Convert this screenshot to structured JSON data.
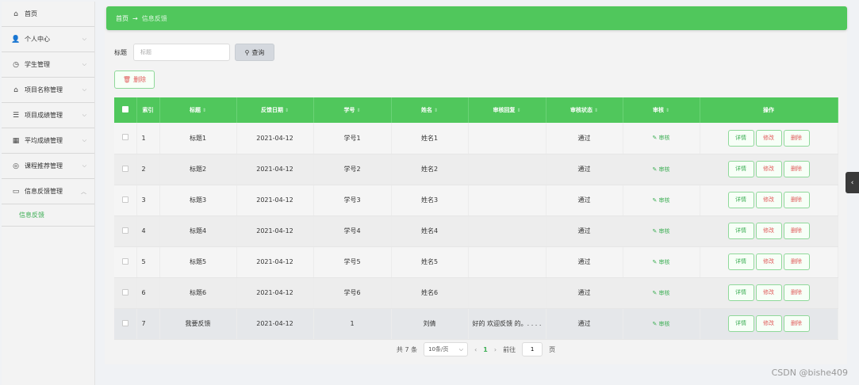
{
  "sidebar": {
    "items": [
      {
        "icon": "home-icon",
        "glyph": "⌂",
        "label": "首页",
        "arrow": ""
      },
      {
        "icon": "user-icon",
        "glyph": "👤",
        "label": "个人中心",
        "arrow": "⌵"
      },
      {
        "icon": "clock-icon",
        "glyph": "◷",
        "label": "学生管理",
        "arrow": "⌵"
      },
      {
        "icon": "bank-icon",
        "glyph": "⌂",
        "label": "项目名称管理",
        "arrow": "⌵"
      },
      {
        "icon": "list-icon",
        "glyph": "☰",
        "label": "项目成绩管理",
        "arrow": "⌵"
      },
      {
        "icon": "grid-icon",
        "glyph": "▦",
        "label": "平均成绩管理",
        "arrow": "⌵"
      },
      {
        "icon": "compass-icon",
        "glyph": "◎",
        "label": "课程推荐管理",
        "arrow": "⌵"
      },
      {
        "icon": "chat-icon",
        "glyph": "▭",
        "label": "信息反馈管理",
        "arrow": "︿"
      }
    ],
    "sub_item": "信息反馈"
  },
  "breadcrumb": {
    "home": "首页",
    "sep": "→",
    "current": "信息反馈"
  },
  "search": {
    "label": "标题",
    "placeholder": "标题",
    "button": "查询"
  },
  "toolbar": {
    "delete_label": "删除"
  },
  "table": {
    "headers": {
      "index": "索引",
      "title": "标题",
      "date": "反馈日期",
      "student_no": "学号",
      "name": "姓名",
      "reply": "审核回复",
      "status": "审核状态",
      "audit": "审核",
      "ops": "操作"
    },
    "rows": [
      {
        "index": "1",
        "title": "标题1",
        "date": "2021-04-12",
        "student_no": "学号1",
        "name": "姓名1",
        "reply": "",
        "status": "通过"
      },
      {
        "index": "2",
        "title": "标题2",
        "date": "2021-04-12",
        "student_no": "学号2",
        "name": "姓名2",
        "reply": "",
        "status": "通过"
      },
      {
        "index": "3",
        "title": "标题3",
        "date": "2021-04-12",
        "student_no": "学号3",
        "name": "姓名3",
        "reply": "",
        "status": "通过"
      },
      {
        "index": "4",
        "title": "标题4",
        "date": "2021-04-12",
        "student_no": "学号4",
        "name": "姓名4",
        "reply": "",
        "status": "通过"
      },
      {
        "index": "5",
        "title": "标题5",
        "date": "2021-04-12",
        "student_no": "学号5",
        "name": "姓名5",
        "reply": "",
        "status": "通过"
      },
      {
        "index": "6",
        "title": "标题6",
        "date": "2021-04-12",
        "student_no": "学号6",
        "name": "姓名6",
        "reply": "",
        "status": "通过"
      },
      {
        "index": "7",
        "title": "我要反馈",
        "date": "2021-04-12",
        "student_no": "1",
        "name": "刘倩",
        "reply": "好的 欢迎反馈 的。. . . .",
        "status": "通过"
      }
    ],
    "audit_label": "审核",
    "op_detail": "详情",
    "op_edit": "修改",
    "op_delete": "删除"
  },
  "pagination": {
    "total": "共 7 条",
    "page_size": "10条/页",
    "prev": "‹",
    "current": "1",
    "next": "›",
    "goto_label": "前往",
    "goto_value": "1",
    "page_suffix": "页"
  },
  "watermark": "CSDN @bishe409",
  "colors": {
    "accent": "#50c75c",
    "danger": "#e05a5a"
  }
}
